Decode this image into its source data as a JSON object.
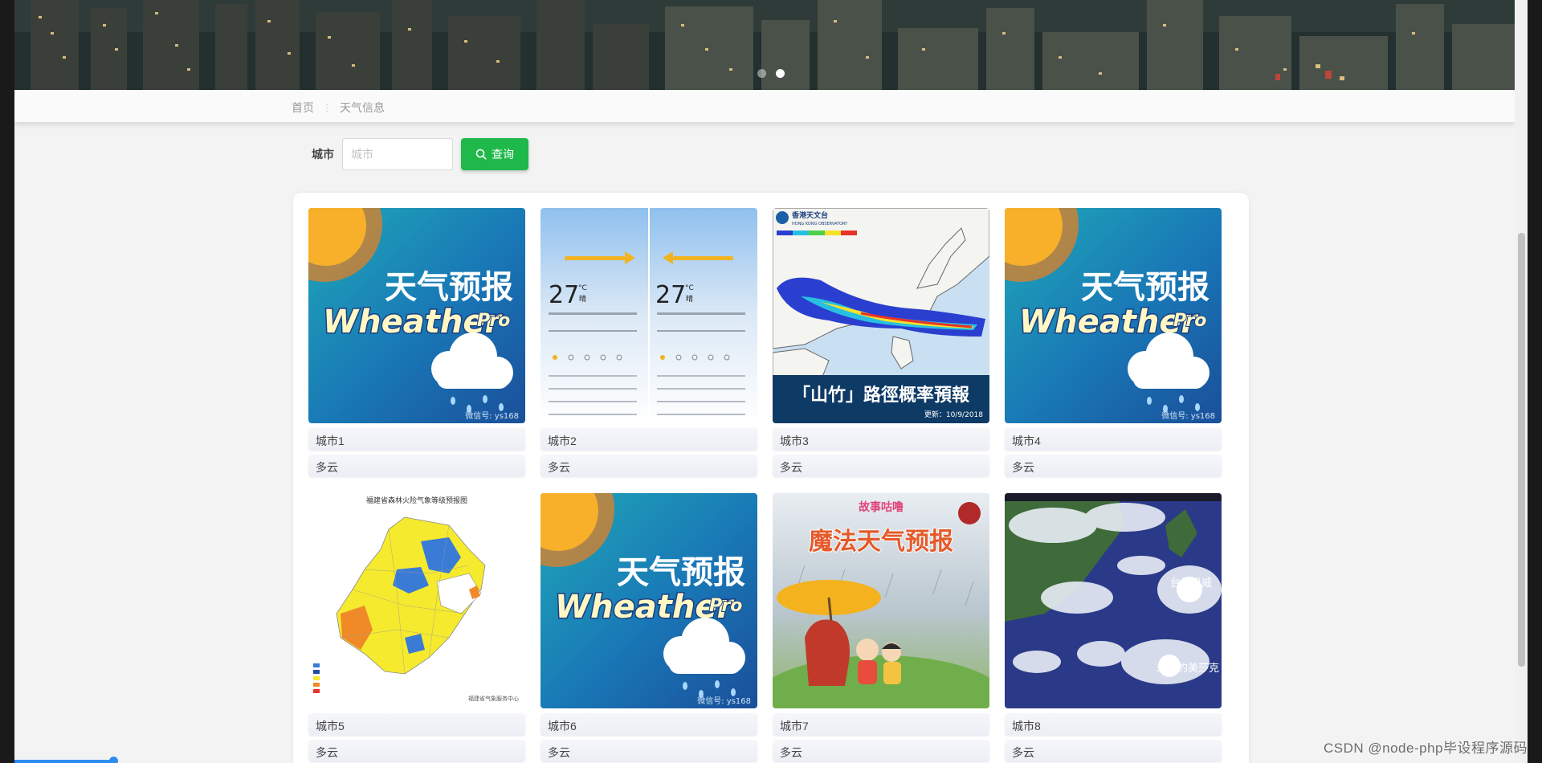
{
  "breadcrumb": {
    "home": "首页",
    "separator": "⋮",
    "current": "天气信息"
  },
  "search": {
    "label": "城市",
    "placeholder": "城市",
    "value": "",
    "button_label": "查询",
    "button_icon": "search-icon"
  },
  "carousel": {
    "slide_count": 2,
    "active_index": 1
  },
  "colors": {
    "accent": "#1fb84a",
    "panel": "#ffffff",
    "page": "#f3f3f3"
  },
  "cards": [
    {
      "city": "城市1",
      "weather": "多云",
      "image": "weather-pro-poster",
      "texts": [
        "天气预报",
        "Wheather",
        "Pro",
        "微信号: ys168"
      ]
    },
    {
      "city": "城市2",
      "weather": "多云",
      "image": "weather-app-screens",
      "texts": [
        "27",
        "°C",
        "晴"
      ]
    },
    {
      "city": "城市3",
      "weather": "多云",
      "image": "typhoon-probability-map",
      "texts": [
        "香港天文台",
        "HONG KONG OBSERVATORY",
        "「山竹」路徑概率預報",
        "更新：10/9/2018"
      ]
    },
    {
      "city": "城市4",
      "weather": "多云",
      "image": "weather-pro-poster",
      "texts": [
        "天气预报",
        "Wheather",
        "Pro",
        "微信号: ys168"
      ]
    },
    {
      "city": "城市5",
      "weather": "多云",
      "image": "forest-fire-risk-map",
      "texts": [
        "福建省森林火险气象等级预报图",
        "福建省气象服务中心"
      ]
    },
    {
      "city": "城市6",
      "weather": "多云",
      "image": "weather-pro-poster",
      "texts": [
        "天气预报",
        "Wheather",
        "Pro",
        "微信号: ys168"
      ]
    },
    {
      "city": "城市7",
      "weather": "多云",
      "image": "magic-weather-book",
      "texts": [
        "故事咕噜",
        "魔法天气预报"
      ]
    },
    {
      "city": "城市8",
      "weather": "多云",
      "image": "satellite-cloud-image",
      "texts": [
        "台風巴威",
        "未来的美莎克"
      ]
    }
  ],
  "watermark": "CSDN @node-php毕设程序源码"
}
